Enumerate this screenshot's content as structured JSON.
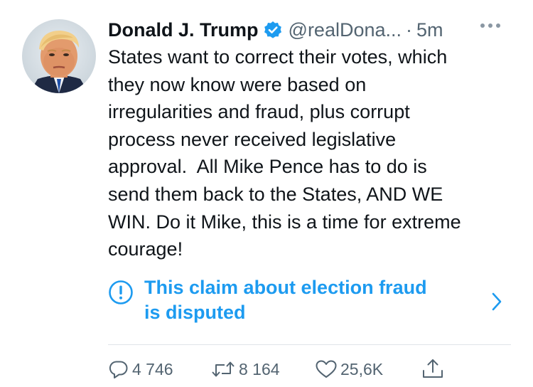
{
  "tweet": {
    "author_name": "Donald J. Trump",
    "handle": "@realDona...",
    "separator": "·",
    "time": "5m",
    "text": "States want to correct their votes, which\nthey now know were based on\nirregularities and fraud, plus corrupt\nprocess never received legislative\napproval.  All Mike Pence has to do is\nsend them back to the States, AND WE\nWIN. Do it Mike, this is a time for extreme\ncourage!",
    "notice": "This claim about election fraud\nis disputed"
  },
  "stats": {
    "replies": "4 746",
    "retweets": "8 164",
    "likes": "25,6K"
  },
  "icons": {
    "avatar": "profile-photo",
    "verified": "verified-badge-icon",
    "more": "more-icon",
    "notice": "exclamation-circle-icon",
    "chevron": "chevron-right-icon",
    "reply": "reply-icon",
    "retweet": "retweet-icon",
    "like": "heart-icon",
    "share": "share-icon"
  },
  "colors": {
    "accent": "#1d9bf0",
    "text": "#0f1419",
    "secondary": "#536471"
  }
}
